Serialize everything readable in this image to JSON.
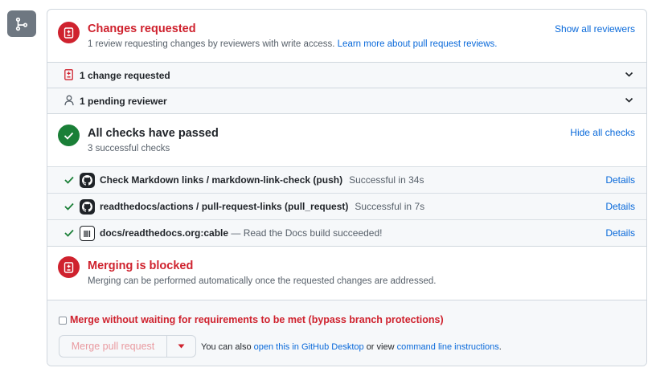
{
  "changes_requested": {
    "title": "Changes requested",
    "subtitle_prefix": "1 review requesting changes by reviewers with write access.",
    "learn_more_link": "Learn more about pull request reviews.",
    "show_all_reviewers": "Show all reviewers",
    "rows": [
      {
        "label": "1 change requested",
        "icon": "file-diff-icon"
      },
      {
        "label": "1 pending reviewer",
        "icon": "person-icon"
      }
    ]
  },
  "checks": {
    "title": "All checks have passed",
    "subtitle": "3 successful checks",
    "hide_all_checks": "Hide all checks",
    "items": [
      {
        "name": "Check Markdown links / markdown-link-check (push)",
        "status": "Successful in 34s",
        "details": "Details",
        "avatar": "github-logo-icon"
      },
      {
        "name": "readthedocs/actions / pull-request-links (pull_request)",
        "status": "Successful in 7s",
        "details": "Details",
        "avatar": "github-logo-icon"
      },
      {
        "name": "docs/readthedocs.org:cable",
        "description": " — Read the Docs build succeeded!",
        "details": "Details",
        "avatar": "readthedocs-logo-icon"
      }
    ]
  },
  "merging": {
    "title": "Merging is blocked",
    "subtitle": "Merging can be performed automatically once the requested changes are addressed."
  },
  "merge_box": {
    "bypass_label": "Merge without waiting for requirements to be met (bypass branch protections)",
    "bypass_checked": false,
    "merge_button": "Merge pull request",
    "alt_prefix": "You can also",
    "desktop_link": "open this in GitHub Desktop",
    "alt_middle": "or view",
    "cli_link": "command line instructions",
    "alt_suffix": "."
  },
  "colors": {
    "danger": "#cf222e",
    "success": "#1a7f37",
    "link": "#0969da",
    "muted": "#57606a"
  }
}
